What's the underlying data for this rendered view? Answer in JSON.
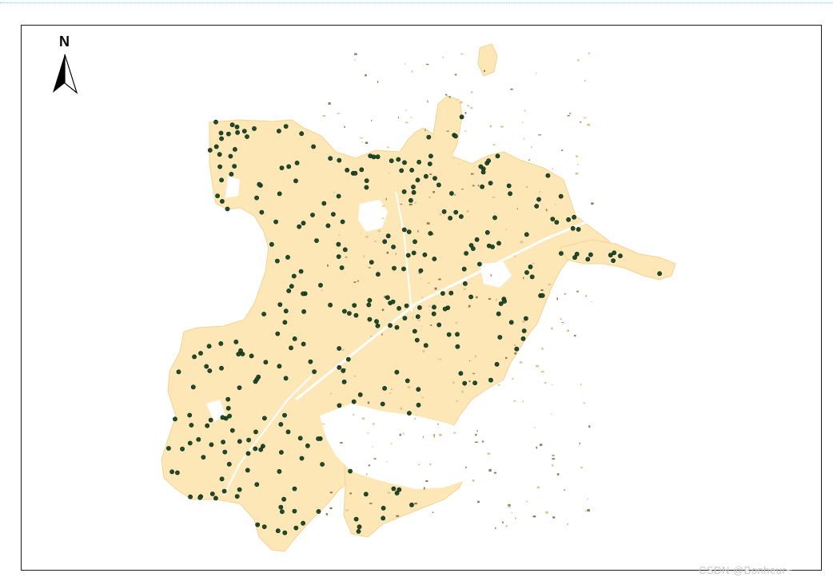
{
  "map": {
    "north_label": "N",
    "land_color": "#fde7b6",
    "land_edge_color": "#f6d79a",
    "point_color": "#1f4d2a",
    "point_stroke": "#0b1f10",
    "frame_color": "#1a1a1a",
    "points_layer": "green-dot-markers"
  },
  "watermark": {
    "text": "CSDN @Bonheur~"
  }
}
